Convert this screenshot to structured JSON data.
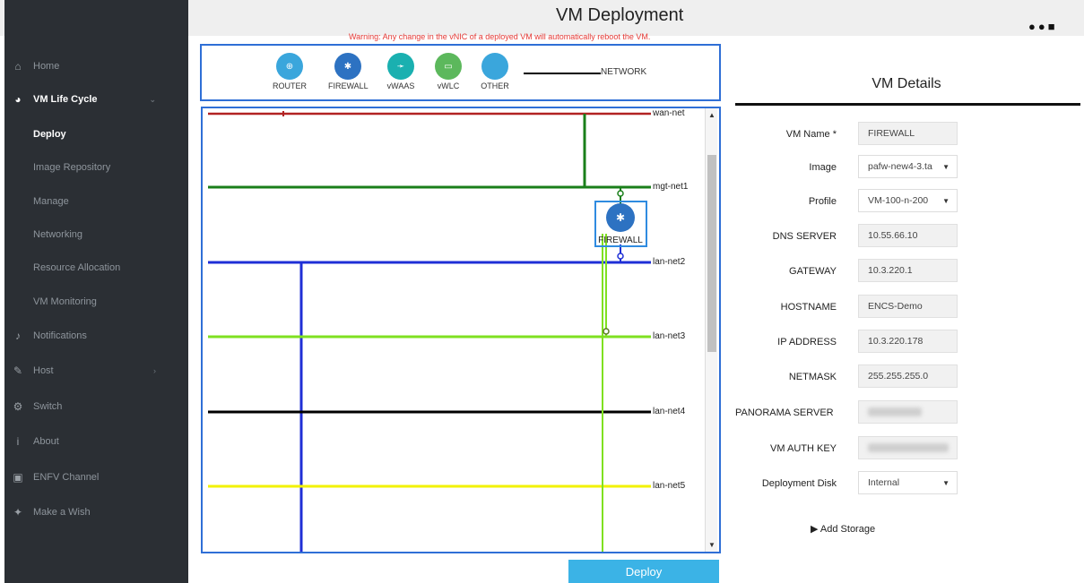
{
  "page": {
    "title": "VM Deployment",
    "warning": "Warning: Any change in the vNIC of a deployed VM will automatically reboot the VM."
  },
  "sidebar": {
    "items": [
      {
        "label": "Home",
        "icon": "home-icon"
      },
      {
        "label": "VM Life Cycle",
        "icon": "pie-chart-icon"
      },
      {
        "label": "Deploy"
      },
      {
        "label": "Image Repository"
      },
      {
        "label": "Manage"
      },
      {
        "label": "Networking"
      },
      {
        "label": "Resource Allocation"
      },
      {
        "label": "VM Monitoring"
      },
      {
        "label": "Notifications",
        "icon": "bell-icon"
      },
      {
        "label": "Host",
        "icon": "wrench-icon"
      },
      {
        "label": "Switch",
        "icon": "gears-icon"
      },
      {
        "label": "About",
        "icon": "info-icon"
      },
      {
        "label": "ENFV Channel",
        "icon": "youtube-icon"
      },
      {
        "label": "Make a Wish",
        "icon": "magic-wand-icon"
      }
    ]
  },
  "palette": {
    "items": [
      {
        "label": "ROUTER",
        "color": "#3aa6dc"
      },
      {
        "label": "FIREWALL",
        "color": "#2d72c2"
      },
      {
        "label": "vWAAS",
        "color": "#1ab0b0"
      },
      {
        "label": "vWLC",
        "color": "#5cb85c"
      },
      {
        "label": "OTHER",
        "color": "#3aa6dc"
      }
    ],
    "network_label": "NETWORK"
  },
  "topology": {
    "networks": [
      {
        "name": "wan-net",
        "color": "#b22222"
      },
      {
        "name": "mgt-net1",
        "color": "#1a7f1a"
      },
      {
        "name": "lan-net2",
        "color": "#1f2fd6"
      },
      {
        "name": "lan-net3",
        "color": "#7fe020"
      },
      {
        "name": "lan-net4",
        "color": "#000000"
      },
      {
        "name": "lan-net5",
        "color": "#f2f200"
      }
    ],
    "vm_label": "FIREWALL"
  },
  "deploy_label": "Deploy",
  "details": {
    "title": "VM Details",
    "fields": [
      {
        "label": "VM Name *",
        "value": "FIREWALL"
      },
      {
        "label": "Image",
        "value": "pafw-new4-3.ta"
      },
      {
        "label": "Profile",
        "value": "VM-100-n-200"
      },
      {
        "label": "DNS SERVER",
        "value": "10.55.66.10"
      },
      {
        "label": "GATEWAY",
        "value": "10.3.220.1"
      },
      {
        "label": "HOSTNAME",
        "value": "ENCS-Demo"
      },
      {
        "label": "IP ADDRESS",
        "value": "10.3.220.178"
      },
      {
        "label": "NETMASK",
        "value": "255.255.255.0"
      },
      {
        "label": "PANORAMA SERVER",
        "value": ""
      },
      {
        "label": "VM AUTH KEY",
        "value": ""
      },
      {
        "label": "Deployment Disk",
        "value": "Internal"
      }
    ],
    "add_storage": "Add Storage"
  }
}
